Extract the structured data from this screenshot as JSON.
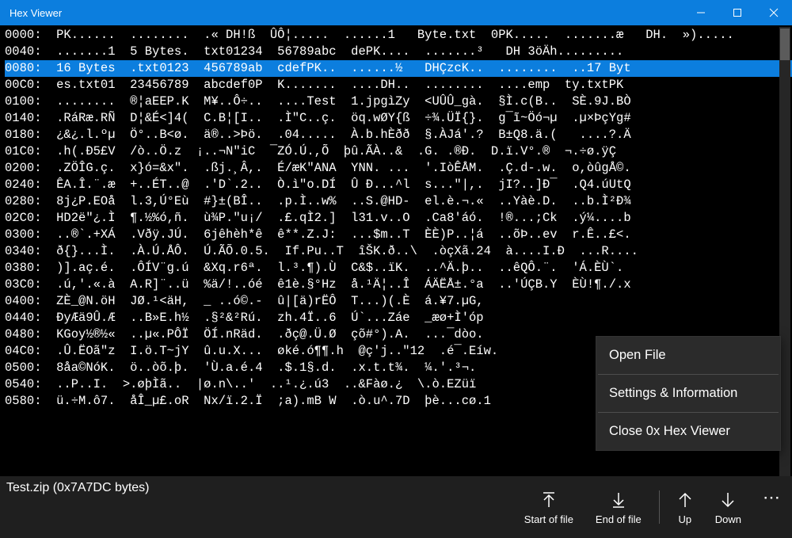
{
  "window": {
    "title": "Hex Viewer"
  },
  "selected_index": 2,
  "hex_lines": [
    "0000:  PK......  ........  .« DH!ß  ÛÔ¦.....  ......1   Byte.txt  0PK.....  .......æ   DH.  »).....",
    "0040:  .......1  5 Bytes.  txt01234  56789abc  dePK....  .......³   DH 3öÄh.........",
    "0080:  16 Bytes  .txt0123  456789ab  cdefPK..  ......½   DHÇzcK..  ........  ..17 Byt",
    "00C0:  es.txt01  23456789  abcdef0P  K.......  ....DH..  ........  ....emp  ty.txtPK",
    "0100:  ........  ®¦aEEP.K  M¥..Ô÷..  ....Test  1.jpgìZy  <UÛÛ_gà.  §Ì.c(B..  SÈ.9J.BÒ",
    "0140:  .RáRæ.RÑ  D¦&É<]4(  C.B¦[I..  .Ì\"C..ç.  öq.wØY{ß  ÷¾.ÜÏ{}.  g¯ĩ~Öó¬µ  .µ×ÞçYg#",
    "0180:  ¿&¿.l.ºµ  Ö°..B<ø.  ä®..>Þö.  .04.....  À.b.hÈðð  §.ÀJá'.?  B±Q8.ä.(   ....?.Ä",
    "01C0:  .h(.Ð5£V  /ò..Ö.z  ¡..¬N\"iC  ¯ZÓ.Ú.,Õ  þû.ÃÀ..&  .G. .®Ð.  D.ï.V°.®  ¬.÷ø.ÿÇ",
    "0200:  .ZÖÎG.ç.  x}ó=&x\".  .ßj.¸Â,.  É/æK\"ANA  YNN. ...  '.IòÊÅM.  .Ç.d-.w.  o,òûgÅ©.",
    "0240:  ÊA.Î.¨.æ  +..ÉT..@  .'D`.2..  Ò.ì\"o.DÍ  Û Ð...^l  s...\"|,.  jI?..]Ð¯  .Q4.úUtQ",
    "0280:  8j¿P.EOå  l.3,Ú°Eù  #}±(BÎ..  .p.Ì..w%  ..S.@HD-  el.è.¬.«  ..Yàè.D.  ..b.Ì²Ð¾",
    "02C0:  HD2ë\"¿.Ì  ¶.½%ó,ñ.  ù¾P.\"u¡/  .£.qÌ2.]  l31.v..O  .Ca8'áó.  !®...;Ck  .ý¼....b",
    "0300:  ..®`.+XÁ  .Vðÿ.JÚ.  6jêhèh*ê  ê**.Z.J:  ...$m..T  ÈÈ)P..¦á  ..õÞ..ev  r.Ê..£<.",
    "0340:  ð{}...Ì.  .À.Ú.ÅÔ.  Ú.ÃÕ.0.5.  If.Pu..T  îŠK.ð..\\  .òçXã.24  à....I.Ð  ...R....",
    "0380:  )].aç.é.  .ÔÍV¨g.ú  &Xq.r6ª.  l.³.¶).Ù  C&$..ïK.  ..^Ä.þ..  ..êQÔ.¨.  'Á.ÈÙ`. ",
    "03C0:  .ú,'.«.à  A.R]¨..ü  %ä/!..óé  ê1è.§°Hz  å.¹Ä¦..Î  ÁÄËÅ±.°a  ..'ÚÇB.Y  ÈÙ!¶./.x",
    "0400:  ZÈ_@N.öH  JØ.¹<äH,  _ ..ó©.-  û|[ä)rËÔ  T...)(.È  á.¥7.µG,",
    "0440:  ÐyÆä9Û.Æ  ..B»E.h½  .§²&²Rú.  zh.4Ï..6  Ú`...Záe  _æø+Ì'óp",
    "0480:  KGoy½®½«  ..µ«.PÔÏ  ÖÍ.nRäd.  .ðç@.Ü.Ø  çõ#°).A.  ...¯dòo.",
    "04C0:  .Û.ËOã\"z  I.ö.T~jY  û.u.X...  øké.ó¶¶.h  @ç'j..\"12  .é¯.Eíw.",
    "0500:  8åa©NóK.  ö..òõ.þ.  'Ù.a.é.4  .$.1§.d.  .x.t.t¾.  ¼.'.³¬.",
    "0540:  ..P..I.  >.øþÌã..  |ø.n\\..'  ..¹.¿.ú3  ..&Fàø.¿  \\.ò.EZüï",
    "0580:  ü.÷M.ô7.  åÎ_µ£.oR  Nx/ï.2.Ï  ;a).mB W  .ò.u^.7D  þè...cø.1"
  ],
  "status": {
    "file_info": "Test.zip (0x7A7DC bytes)"
  },
  "commands": {
    "start": "Start of file",
    "end": "End of file",
    "up": "Up",
    "down": "Down"
  },
  "menu": {
    "open": "Open File",
    "settings": "Settings & Information",
    "close": "Close 0x Hex Viewer"
  }
}
